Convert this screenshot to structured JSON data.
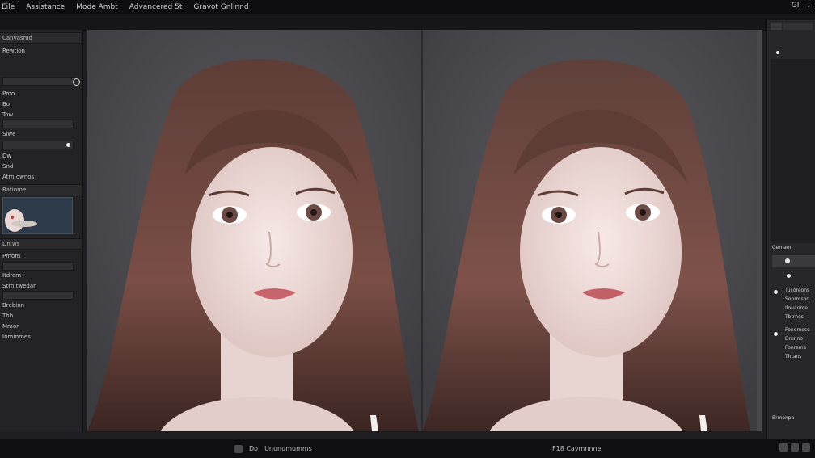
{
  "menu": [
    "Eile",
    "Assistance",
    "Mode Ambt",
    "Advancered 5t",
    "Gravot Gnlinnd"
  ],
  "menu_right": [
    "GI",
    "⌄"
  ],
  "left_panel": {
    "rows": [
      "Canvasmd",
      "Rewtion",
      "Pmo",
      "Bo",
      "Tow",
      "Siwe",
      "Dw",
      "Snd",
      "Atrn ownos",
      "Ratinme",
      "Dn.ws",
      "Pmom",
      "Itdrom",
      "Strn twedan",
      "Brebinn",
      "Thh",
      "Mmon",
      "Inmmmes"
    ]
  },
  "right_panel": {
    "rows": [
      "Gemaon",
      "Tucoreons",
      "Sonrmson",
      "Ilouanme",
      "Tbtrnes",
      "Fonomose",
      "Drnnno",
      "Fonreme",
      "Thtans",
      "Brmonpa"
    ]
  },
  "status": {
    "left_label": "Ununumumms",
    "left_prefix": "Do",
    "mid_label": "F18 Cavmnnne"
  }
}
